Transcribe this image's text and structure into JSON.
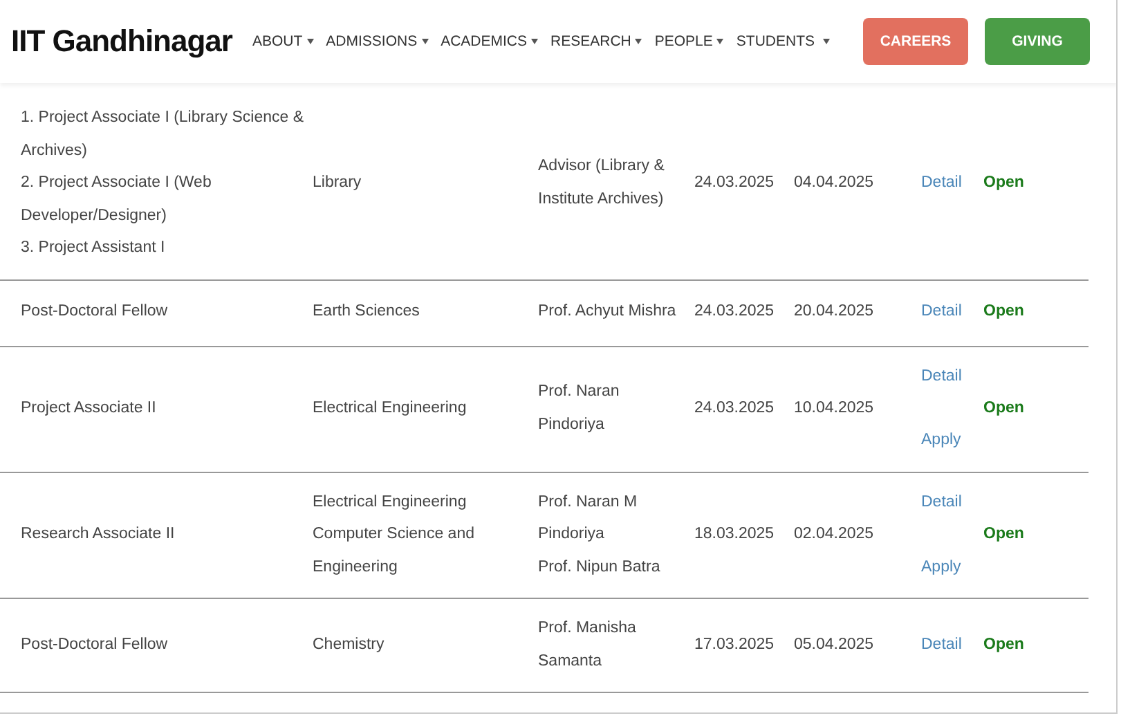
{
  "header": {
    "logo": "IIT Gandhinagar",
    "nav": [
      {
        "label": "ABOUT"
      },
      {
        "label": "ADMISSIONS"
      },
      {
        "label": "ACADEMICS"
      },
      {
        "label": "RESEARCH"
      },
      {
        "label": "PEOPLE"
      },
      {
        "label": "STUDENTS"
      }
    ],
    "buttons": [
      {
        "label": "CAREERS",
        "color": "#e2705f"
      },
      {
        "label": "GIVING",
        "color": "#4b9d47"
      }
    ]
  },
  "table": {
    "rows": [
      {
        "position": [
          "1. Project Associate I (Library Science &",
          "Archives)",
          "2. Project Associate I (Web",
          "Developer/Designer)",
          "3. Project Assistant I"
        ],
        "department": [
          "Library"
        ],
        "contact": [
          "Advisor (Library &",
          "Institute Archives)"
        ],
        "start": "24.03.2025",
        "end": "04.04.2025",
        "links": [
          "Detail"
        ],
        "status": "Open"
      },
      {
        "position": [
          "Post-Doctoral Fellow"
        ],
        "department": [
          "Earth Sciences"
        ],
        "contact": [
          "Prof. Achyut Mishra"
        ],
        "start": "24.03.2025",
        "end": "20.04.2025",
        "links": [
          "Detail"
        ],
        "status": "Open"
      },
      {
        "position": [
          "Project Associate II"
        ],
        "department": [
          "Electrical Engineering"
        ],
        "contact": [
          "Prof. Naran",
          "Pindoriya"
        ],
        "start": "24.03.2025",
        "end": "10.04.2025",
        "links": [
          "Detail",
          "Apply"
        ],
        "status": "Open"
      },
      {
        "position": [
          "Research Associate II"
        ],
        "department": [
          "Electrical Engineering",
          "Computer Science and",
          "Engineering"
        ],
        "contact": [
          "Prof. Naran M",
          "Pindoriya",
          "Prof. Nipun Batra"
        ],
        "start": "18.03.2025",
        "end": "02.04.2025",
        "links": [
          "Detail",
          "Apply"
        ],
        "status": "Open"
      },
      {
        "position": [
          "Post-Doctoral Fellow"
        ],
        "department": [
          "Chemistry"
        ],
        "contact": [
          "Prof. Manisha",
          "Samanta"
        ],
        "start": "17.03.2025",
        "end": "05.04.2025",
        "links": [
          "Detail"
        ],
        "status": "Open"
      }
    ]
  }
}
